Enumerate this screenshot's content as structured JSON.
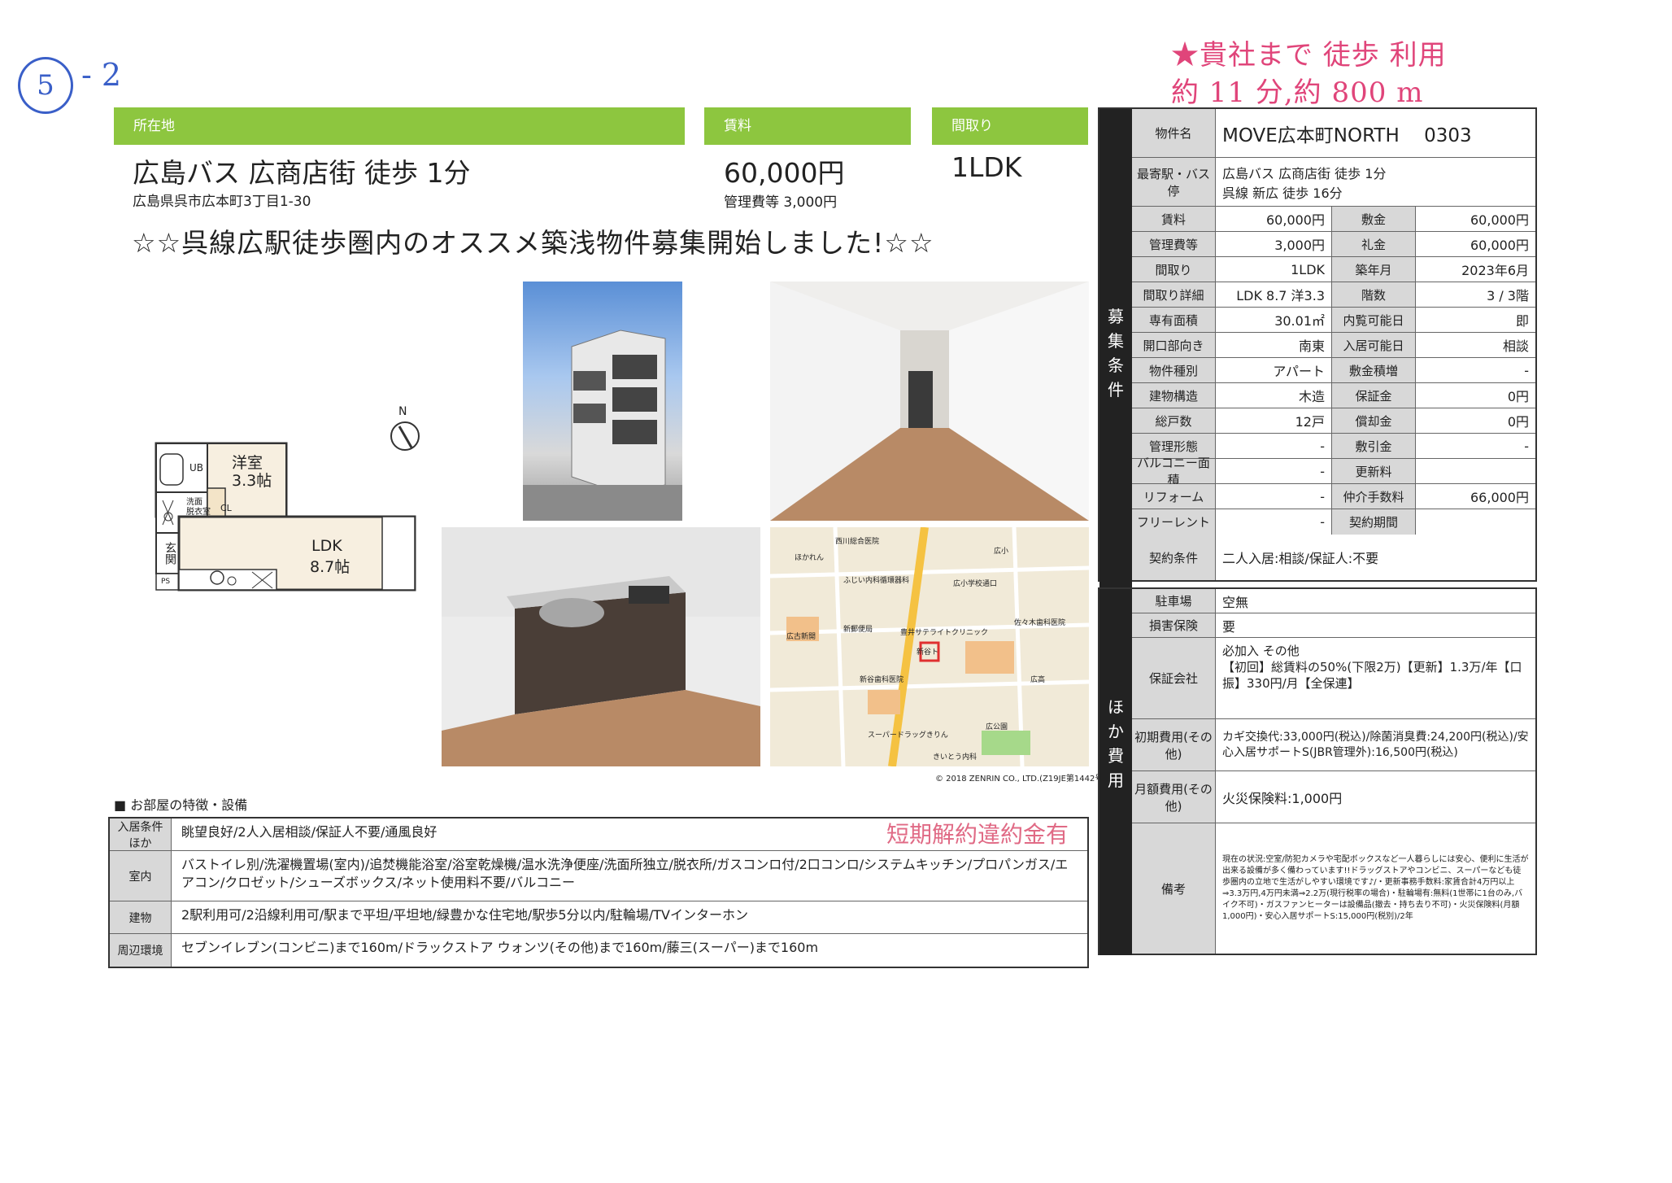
{
  "handwritten": {
    "circle_num": "5",
    "dash_num": "- 2",
    "note_line1": "★貴社まで 徒歩  利用",
    "note_line2": "約  11  分,約 800 m"
  },
  "header": {
    "location_label": "所在地",
    "location_main": "広島バス 広商店街 徒歩 1分",
    "address": "広島県呉市広本町3丁目1-30",
    "rent_label": "賃料",
    "rent_value": "60,000円",
    "mgmt_fee": "管理費等 3,000円",
    "layout_label": "間取り",
    "layout_value": "1LDK"
  },
  "catch_copy": "☆☆呉線広駅徒歩圏内のオススメ築浅物件募集開始しました!☆☆",
  "floorplan": {
    "room1": "洋室",
    "room1_size": "3.3帖",
    "ub": "UB",
    "wash": "洗面\n脱衣室",
    "cl": "CL",
    "ldk": "LDK",
    "ldk_size": "8.7帖",
    "entrance": "玄関",
    "ps": "PS",
    "north": "N"
  },
  "map_copyright": "© 2018 ZENRIN CO., LTD.(Z19JE第1442号)",
  "map_labels": [
    "西川総合医院",
    "広小",
    "広小学校通口",
    "広古新開",
    "新郵便局",
    "広高",
    "佐々木歯科医院",
    "ほかれん",
    "新谷歯科医院",
    "スーパードラッグきりん",
    "広公園",
    "きいとう内科",
    "豊井サテライトクリニック",
    "ふじい内科循環器科",
    "新谷ト"
  ],
  "details": {
    "property_name_label": "物件名",
    "property_name": "MOVE広本町NORTH　 0303",
    "station_label": "最寄駅・バス停",
    "station_line1": "広島バス 広商店街 徒歩 1分",
    "station_line2": "呉線 新広 徒歩 16分",
    "side_label_1": [
      "募",
      "集",
      "条",
      "件"
    ],
    "rows": [
      {
        "l1": "賃料",
        "v1": "60,000円",
        "l2": "敷金",
        "v2": "60,000円"
      },
      {
        "l1": "管理費等",
        "v1": "3,000円",
        "l2": "礼金",
        "v2": "60,000円"
      },
      {
        "l1": "間取り",
        "v1": "1LDK",
        "l2": "築年月",
        "v2": "2023年6月"
      },
      {
        "l1": "間取り詳細",
        "v1": "LDK 8.7 洋3.3",
        "l2": "階数",
        "v2": "3 / 3階"
      },
      {
        "l1": "専有面積",
        "v1": "30.01㎡",
        "l2": "内覧可能日",
        "v2": "即"
      },
      {
        "l1": "開口部向き",
        "v1": "南東",
        "l2": "入居可能日",
        "v2": "相談"
      },
      {
        "l1": "物件種別",
        "v1": "アパート",
        "l2": "敷金積増",
        "v2": "-"
      },
      {
        "l1": "建物構造",
        "v1": "木造",
        "l2": "保証金",
        "v2": "0円"
      },
      {
        "l1": "総戸数",
        "v1": "12戸",
        "l2": "償却金",
        "v2": "0円"
      },
      {
        "l1": "管理形態",
        "v1": "-",
        "l2": "敷引金",
        "v2": "-"
      },
      {
        "l1": "バルコニー面積",
        "v1": "-",
        "l2": "更新料",
        "v2": ""
      },
      {
        "l1": "リフォーム",
        "v1": "-",
        "l2": "仲介手数料",
        "v2": "66,000円"
      },
      {
        "l1": "フリーレント",
        "v1": "-",
        "l2": "契約期間",
        "v2": ""
      }
    ],
    "contract_label": "契約条件",
    "contract_value": "二人入居:相談/保証人:不要",
    "side_label_2": [
      "ほ",
      "か",
      "費",
      "用"
    ],
    "parking_label": "駐車場",
    "parking_value": "空無",
    "insurance_label": "損害保険",
    "insurance_value": "要",
    "guarantor_label": "保証会社",
    "guarantor_value": "必加入 その他\n【初回】総賃料の50%(下限2万)【更新】1.3万/年【口振】330円/月【全保連】",
    "initial_label": "初期費用(その他)",
    "initial_value": "カギ交換代:33,000円(税込)/除菌消臭費:24,200円(税込)/安心入居サポートS(JBR管理外):16,500円(税込)",
    "monthly_label": "月額費用(その他)",
    "monthly_value": "火災保険料:1,000円",
    "remarks_label": "備考",
    "remarks_value": "現在の状況:空室/防犯カメラや宅配ボックスなど一人暮らしには安心、便利に生活が出来る設備が多く備わっています!!ドラッグストアやコンビニ、スーパーなども徒歩圏内の立地で生活がしやすい環境です♪/・更新事務手数料:家賃合計4万円以上⇒3.3万円,4万円未満⇒2.2万(現行税率の場合)・駐輪場有:無料(1世帯に1台のみ,バイク不可)・ガスファンヒーターは設備品(撤去・持ち去り不可)・火災保険料(月額1,000円)・安心入居サポートS:15,000円(税別)/2年"
  },
  "features": {
    "title": "■ お部屋の特徴・設備",
    "stamp": "短期解約違約金有",
    "rows": [
      {
        "label": "入居条件ほか",
        "value": "眺望良好/2人入居相談/保証人不要/通風良好"
      },
      {
        "label": "室内",
        "value": "バストイレ別/洗濯機置場(室内)/追焚機能浴室/浴室乾燥機/温水洗浄便座/洗面所独立/脱衣所/ガスコンロ付/2口コンロ/システムキッチン/プロパンガス/エアコン/クロゼット/シューズボックス/ネット使用料不要/バルコニー"
      },
      {
        "label": "建物",
        "value": "2駅利用可/2沿線利用可/駅まで平坦/平坦地/緑豊かな住宅地/駅歩5分以内/駐輪場/TVインターホン"
      },
      {
        "label": "周辺環境",
        "value": "セブンイレブン(コンビニ)まで160m/ドラックストア ウォンツ(その他)まで160m/藤三(スーパー)まで160m"
      }
    ]
  }
}
